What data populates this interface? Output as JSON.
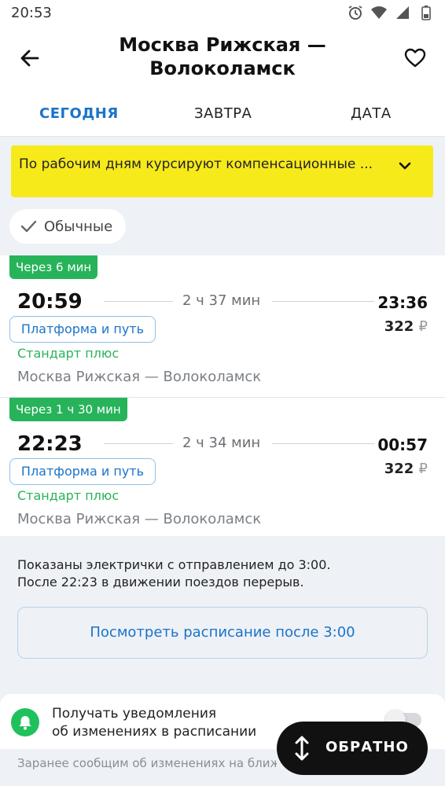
{
  "status": {
    "time": "20:53"
  },
  "header": {
    "title": "Москва Рижская — Волоколамск"
  },
  "tabs": [
    {
      "label": "СЕГОДНЯ",
      "active": true
    },
    {
      "label": "ЗАВТРА",
      "active": false
    },
    {
      "label": "ДАТА",
      "active": false
    }
  ],
  "notice": {
    "text": "По рабочим дням курсируют компенсационные ..."
  },
  "filter": {
    "label": "Обычные",
    "checked": true
  },
  "trains": [
    {
      "badge": "Через 6 мин",
      "departure": "20:59",
      "duration": "2 ч  37 мин",
      "arrival": "23:36",
      "price": "322",
      "currency": "₽",
      "platform_button": "Платформа и путь",
      "class": "Стандарт плюс",
      "route": "Москва Рижская — Волоколамск"
    },
    {
      "badge": "Через 1 ч 30 мин",
      "departure": "22:23",
      "duration": "2 ч  34 мин",
      "arrival": "00:57",
      "price": "322",
      "currency": "₽",
      "platform_button": "Платформа и путь",
      "class": "Стандарт плюс",
      "route": "Москва Рижская — Волоколамск"
    }
  ],
  "info": {
    "line1": "Показаны электрички с отправлением до 3:00.",
    "line2": "После 22:23 в движении поездов перерыв."
  },
  "more_button": "Посмотреть расписание после 3:00",
  "notify": {
    "line1": "Получать уведомления",
    "line2": "об изменениях в расписании",
    "enabled": false
  },
  "hint": "Заранее сообщим об изменениях на ближайшие",
  "back_fab": {
    "label": "ОБРАТНО"
  },
  "colors": {
    "accent": "#1a74c9",
    "green": "#27b35a",
    "notice": "#f7ea1b"
  }
}
